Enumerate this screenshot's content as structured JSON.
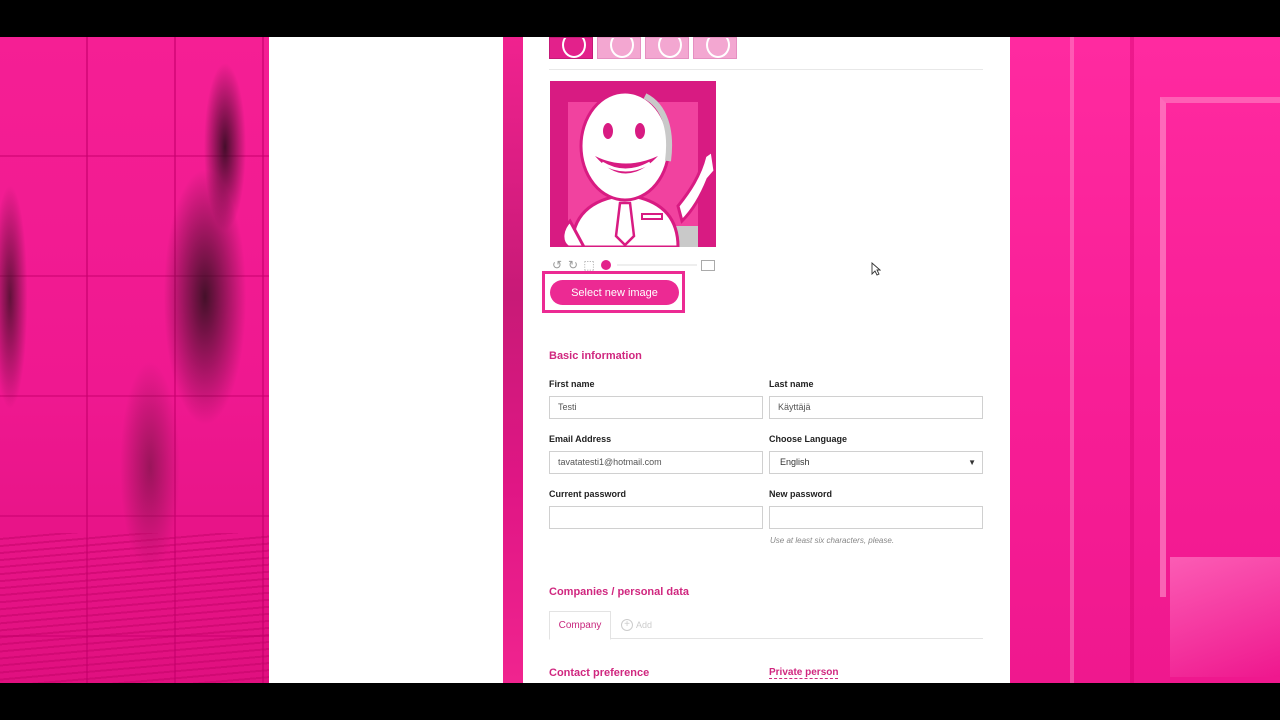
{
  "avatar": {
    "tools": [
      "rotate-left-icon",
      "rotate-right-icon",
      "crop-small-icon",
      "image-large-icon"
    ],
    "select_button_label": "Select new image"
  },
  "basic_info": {
    "title": "Basic information",
    "first_name_label": "First name",
    "first_name_value": "Testi",
    "last_name_label": "Last name",
    "last_name_value": "Käyttäjä",
    "email_label": "Email Address",
    "email_value": "tavatatesti1@hotmail.com",
    "language_label": "Choose Language",
    "language_value": "English",
    "current_password_label": "Current password",
    "new_password_label": "New password",
    "password_hint": "Use at least six characters, please."
  },
  "companies": {
    "title": "Companies / personal data",
    "tab_company": "Company",
    "tab_add": "Add"
  },
  "contact": {
    "title": "Contact preference",
    "private_person": "Private person"
  },
  "colors": {
    "accent": "#ec2a93",
    "heading": "#d0277f",
    "background_pink": "#f51f94"
  }
}
